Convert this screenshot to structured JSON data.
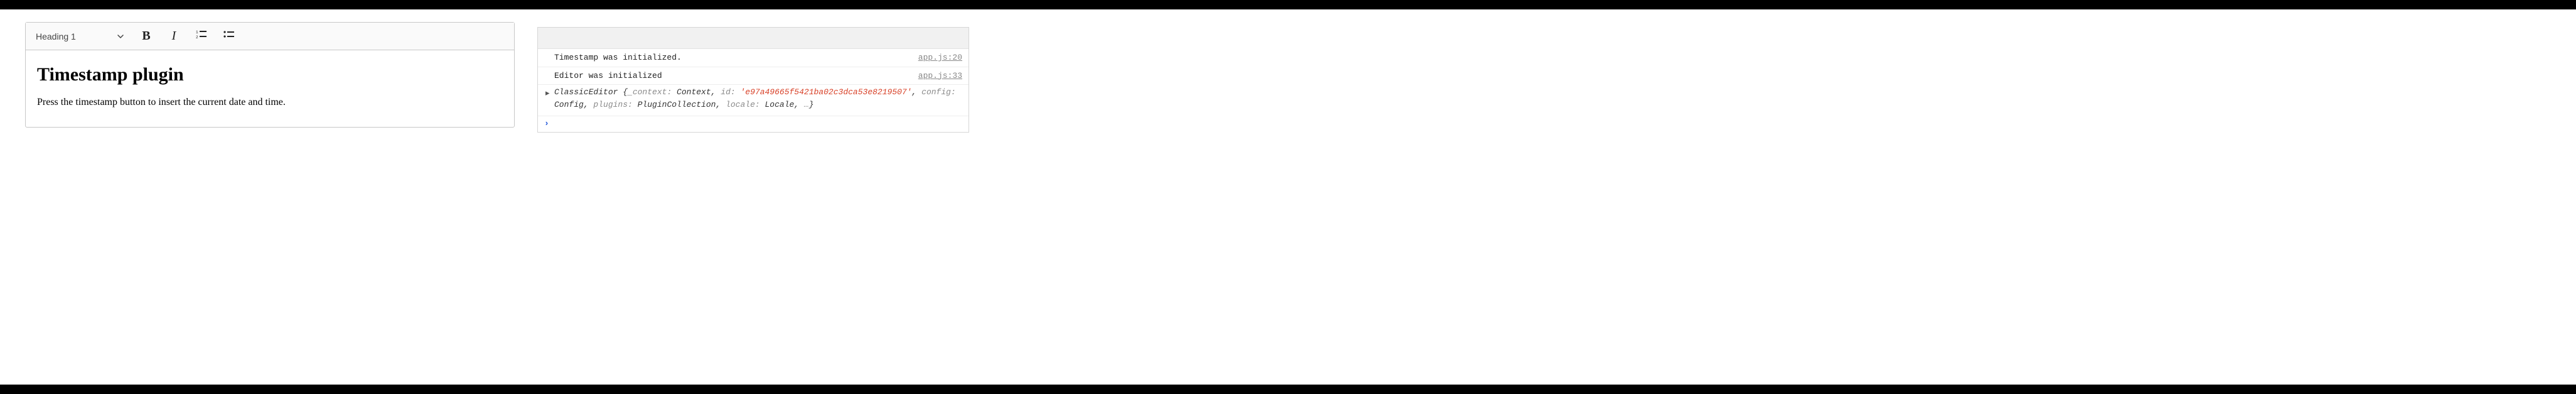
{
  "editor": {
    "toolbar": {
      "heading_select_label": "Heading 1",
      "bold_label": "B",
      "italic_label": "I"
    },
    "content": {
      "heading": "Timestamp plugin",
      "paragraph": "Press the timestamp button to insert the current date and time."
    }
  },
  "console": {
    "rows": [
      {
        "message": "Timestamp was initialized.",
        "source": "app.js:20"
      },
      {
        "message": "Editor was initialized",
        "source": "app.js:33"
      }
    ],
    "object_dump": {
      "class_name": "ClassicEditor",
      "open_brace": " {",
      "props": {
        "context_key": "_context:",
        "context_val": " Context",
        "id_key": "id:",
        "id_val": " 'e97a49665f5421ba02c3dca53e8219507'",
        "config_key": "config:",
        "config_val": " Config",
        "plugins_key": "plugins:",
        "plugins_val": " PluginCollection",
        "locale_key": "locale:",
        "locale_val": " Locale",
        "ellipsis": " …"
      },
      "close_brace": "}"
    },
    "prompt_symbol": "›"
  }
}
